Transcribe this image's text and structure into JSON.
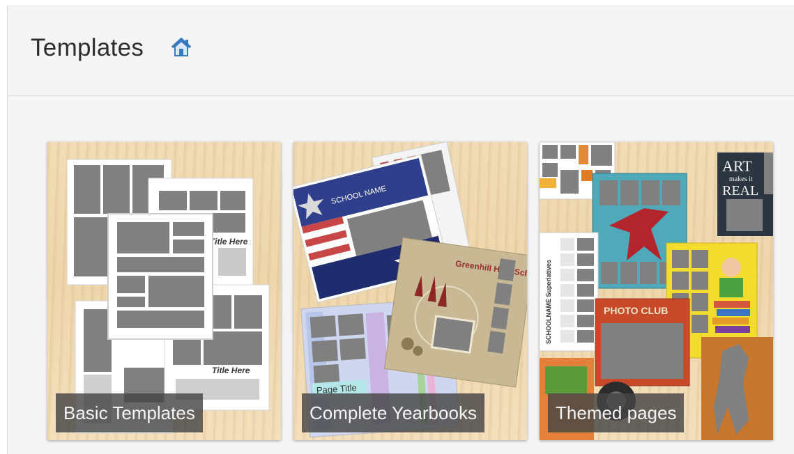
{
  "header": {
    "title": "Templates",
    "home_icon": "home-icon"
  },
  "cards": [
    {
      "label": "Basic Templates",
      "thumb": {
        "page_headings": [
          "Title Here",
          "Title Here"
        ]
      }
    },
    {
      "label": "Complete Yearbooks",
      "thumb": {
        "school_name": "SCHOOL NAME",
        "school_title": "Greenhill High School",
        "page_title": "Page Title"
      }
    },
    {
      "label": "Themed pages",
      "thumb": {
        "art_lines": [
          "ART",
          "makes it",
          "REAL"
        ],
        "photo_club": "PHOTO CLUB",
        "superlatives": "SCHOOLNAME Superlatives"
      }
    }
  ],
  "colors": {
    "placeholder_gray": "#808080",
    "label_bg": "#464646",
    "wood": "#efd8b0"
  }
}
